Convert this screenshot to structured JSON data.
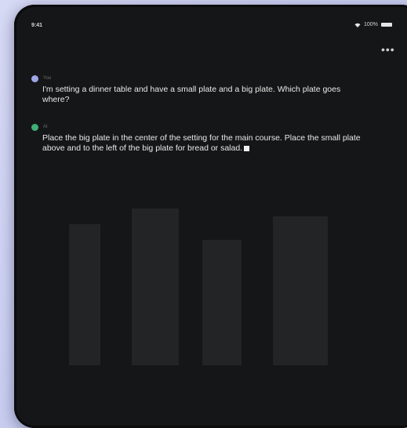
{
  "status_bar": {
    "time": "9:41",
    "battery": "100%"
  },
  "menu": {
    "more_label": "•••"
  },
  "messages": [
    {
      "role": "user",
      "author": "You",
      "text": "I'm setting a dinner table and have a small plate and a big plate. Which plate goes where?"
    },
    {
      "role": "assistant",
      "author": "AI",
      "text": "Place the big plate in the center of the setting for the main course. Place the small plate above and to the left of the big plate for bread or salad."
    }
  ],
  "colors": {
    "screen_bg": "#151617",
    "text": "#e9e9e9",
    "assistant_avatar": "#3fae78",
    "user_avatar": "#9fa6e6"
  }
}
